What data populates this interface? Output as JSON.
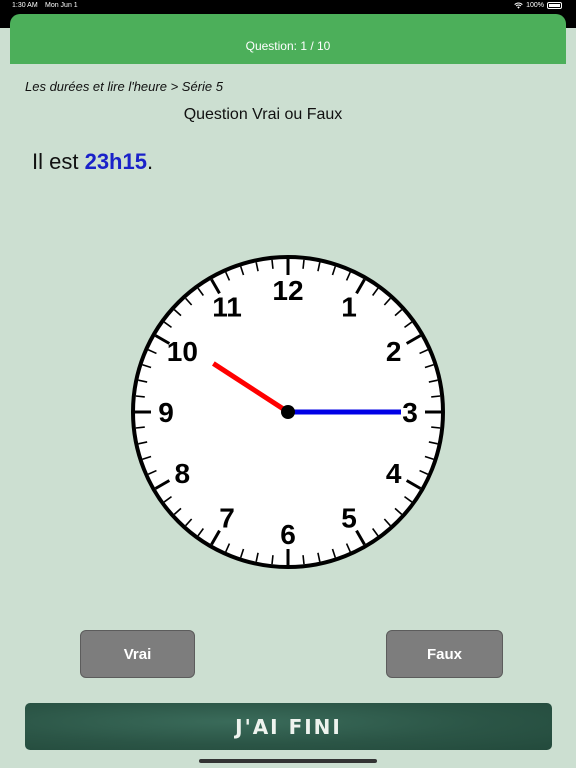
{
  "status_bar": {
    "time": "1:30 AM",
    "date": "Mon Jun 1",
    "battery": "100%"
  },
  "header": {
    "question_counter": "Question: 1 / 10"
  },
  "breadcrumb": "Les durées et lire l'heure > Série 5",
  "question_type": "Question Vrai ou Faux",
  "statement": {
    "prefix": "Il est ",
    "time_value": "23h15",
    "suffix": "."
  },
  "clock": {
    "numbers": [
      "12",
      "1",
      "2",
      "3",
      "4",
      "5",
      "6",
      "7",
      "8",
      "9",
      "10",
      "11"
    ],
    "hour_hand_angle_deg": 303,
    "minute_hand_angle_deg": 90,
    "hour_hand_color": "#ff0000",
    "minute_hand_color": "#0000e6"
  },
  "buttons": {
    "true_label": "Vrai",
    "false_label": "Faux",
    "finish_label": "J'AI FINI"
  },
  "colors": {
    "header_green": "#4caf5a",
    "background": "#ccdfd1",
    "time_blue": "#1a22c9"
  }
}
